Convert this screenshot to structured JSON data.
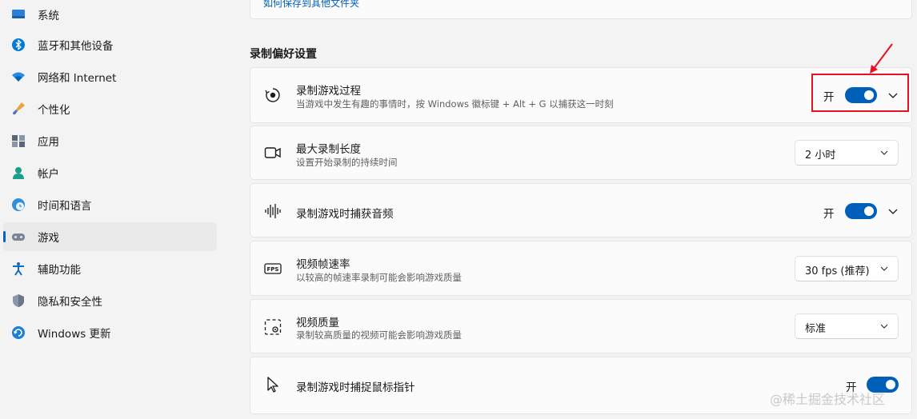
{
  "sidebar": {
    "items": [
      {
        "label": "系统",
        "icon": "monitor-icon"
      },
      {
        "label": "蓝牙和其他设备",
        "icon": "bluetooth-icon"
      },
      {
        "label": "网络和 Internet",
        "icon": "wifi-icon"
      },
      {
        "label": "个性化",
        "icon": "brush-icon"
      },
      {
        "label": "应用",
        "icon": "apps-icon"
      },
      {
        "label": "帐户",
        "icon": "person-icon"
      },
      {
        "label": "时间和语言",
        "icon": "clock-globe-icon"
      },
      {
        "label": "游戏",
        "icon": "gamepad-icon",
        "active": true
      },
      {
        "label": "辅助功能",
        "icon": "accessibility-icon"
      },
      {
        "label": "隐私和安全性",
        "icon": "shield-icon"
      },
      {
        "label": "Windows 更新",
        "icon": "update-icon"
      }
    ]
  },
  "top_card": {
    "link": "如何保存到其他文件夹"
  },
  "section": {
    "title": "录制偏好设置"
  },
  "settings": {
    "record_game": {
      "title": "录制游戏过程",
      "desc": "当游戏中发生有趣的事情时，按 Windows 徽标键 + Alt + G 以捕获这一时刻",
      "toggle_label": "开",
      "on": true,
      "icon": "record-icon"
    },
    "max_length": {
      "title": "最大录制长度",
      "desc": "设置开始录制的持续时间",
      "value": "2 小时",
      "icon": "video-camera-icon"
    },
    "capture_audio": {
      "title": "录制游戏时捕获音频",
      "toggle_label": "开",
      "on": true,
      "icon": "audio-wave-icon"
    },
    "frame_rate": {
      "title": "视频帧速率",
      "desc": "以较高的帧速率录制可能会影响游戏质量",
      "value": "30 fps (推荐)",
      "icon": "fps-icon"
    },
    "video_quality": {
      "title": "视频质量",
      "desc": "录制较高质量的视频可能会影响游戏质量",
      "value": "标准",
      "icon": "video-quality-icon"
    },
    "capture_cursor": {
      "title": "录制游戏时捕捉鼠标指针",
      "toggle_label": "开",
      "on": true,
      "icon": "cursor-icon"
    }
  },
  "annotation": {
    "color": "#e81123"
  },
  "accent": "#005fb8",
  "watermark": "@稀土掘金技术社区"
}
